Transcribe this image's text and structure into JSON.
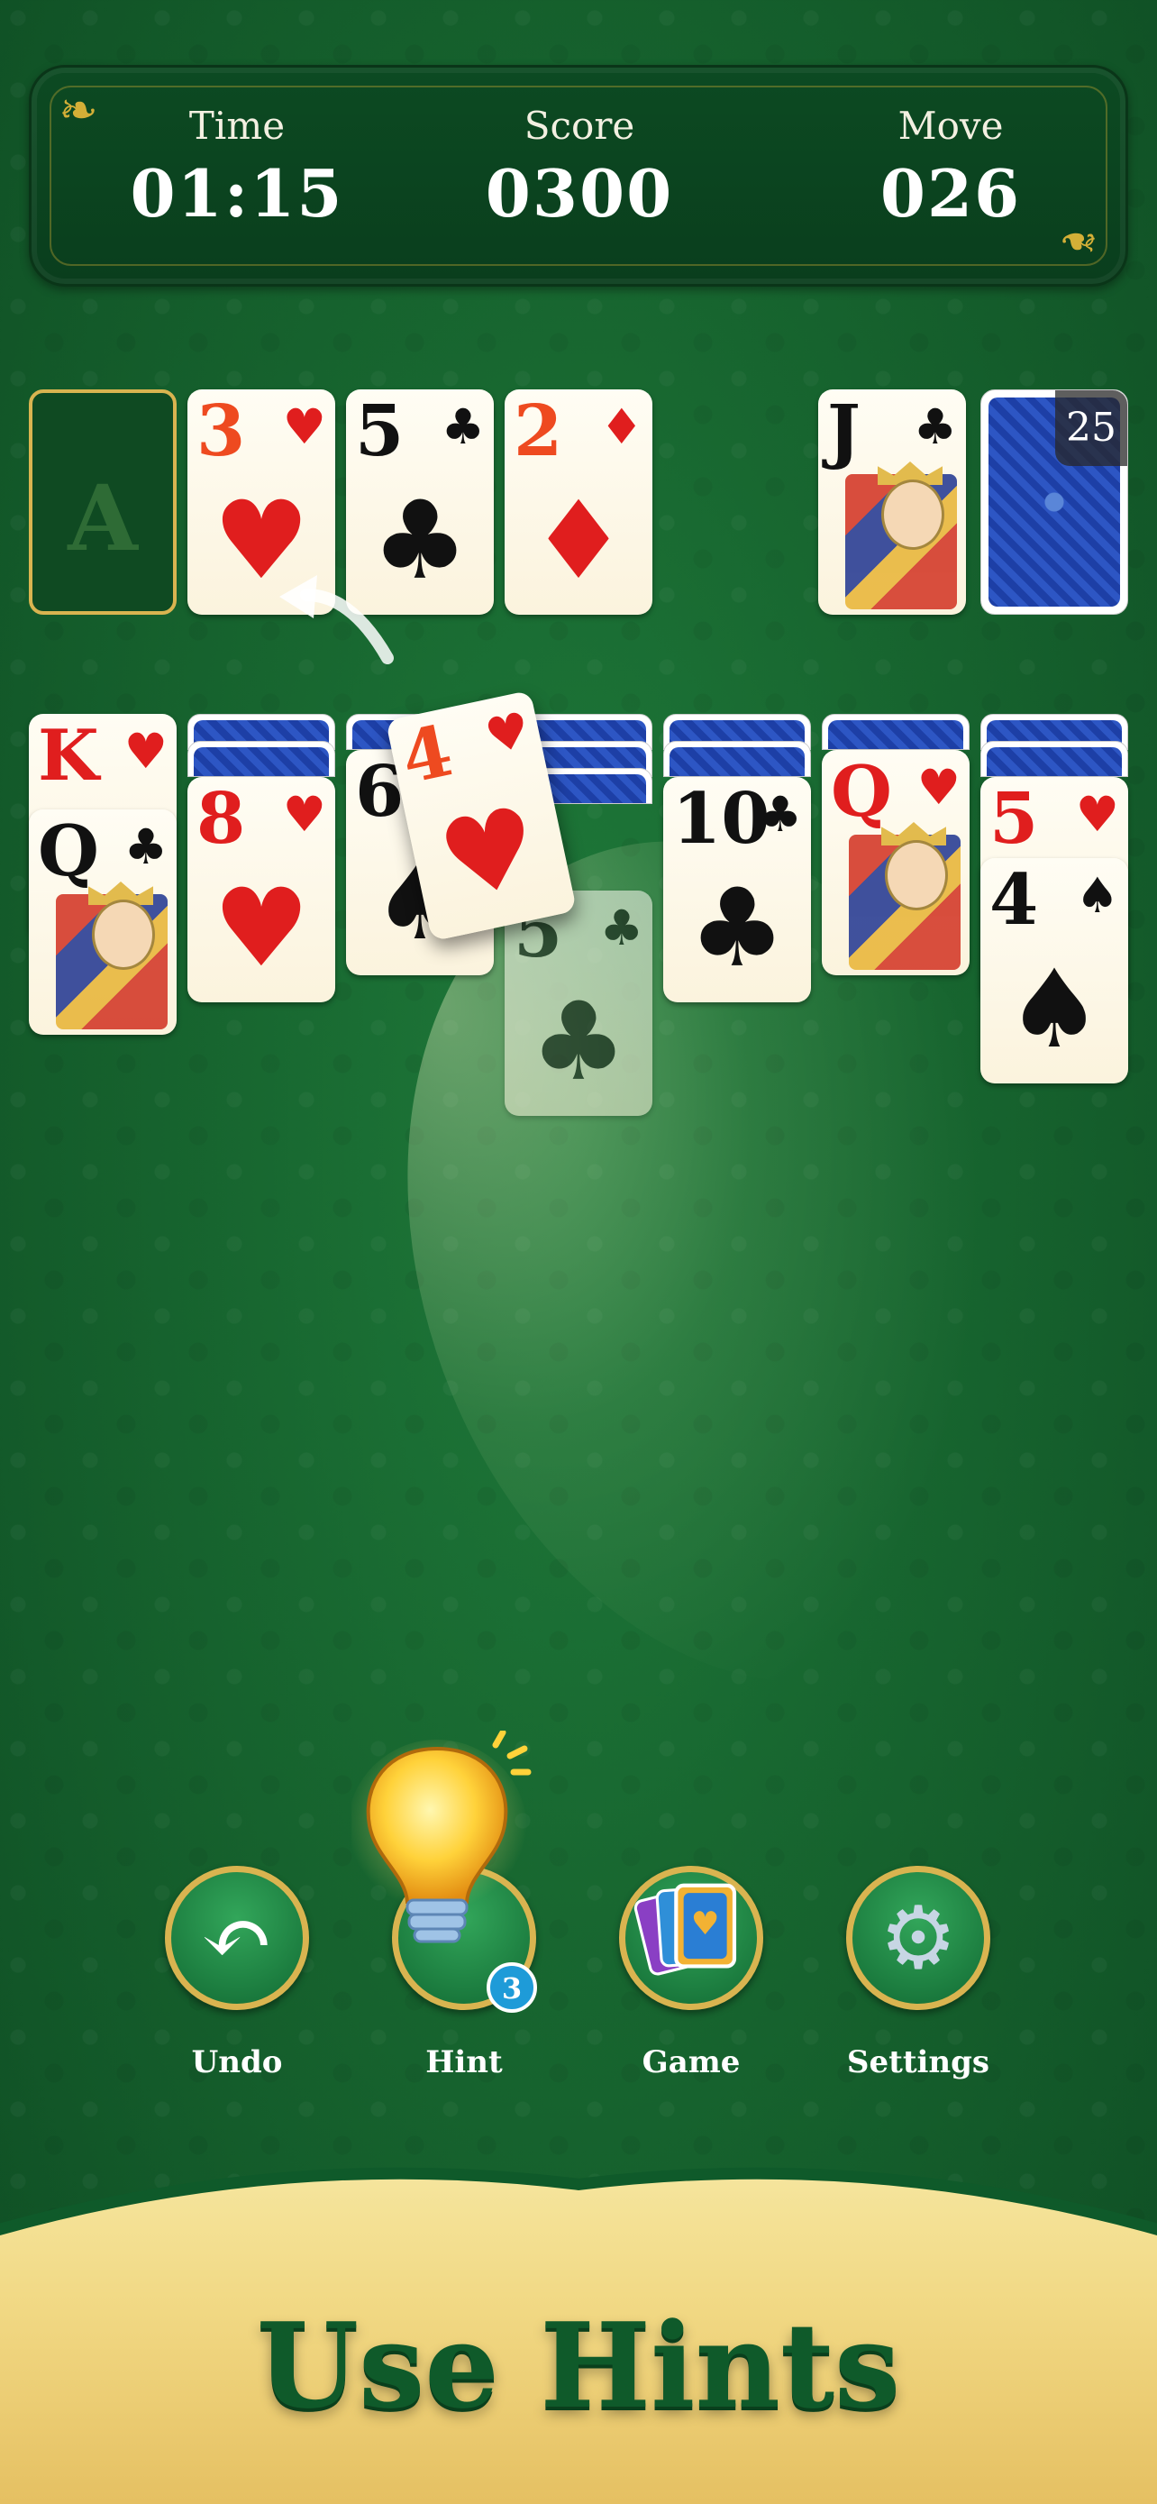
{
  "stats": {
    "time_label": "Time",
    "time_value": "01:15",
    "score_label": "Score",
    "score_value": "0300",
    "move_label": "Move",
    "move_value": "026"
  },
  "foundation": {
    "empty_label": "A",
    "cards": [
      {
        "rank": "3",
        "suit": "♥"
      },
      {
        "rank": "5",
        "suit": "♣"
      },
      {
        "rank": "2",
        "suit": "♦"
      }
    ]
  },
  "waste": {
    "rank": "J",
    "suit": "♣"
  },
  "stock": {
    "count": "25"
  },
  "tableau": [
    {
      "cards": [
        {
          "rank": "K",
          "suit": "♥"
        },
        {
          "rank": "Q",
          "suit": "♣"
        }
      ]
    },
    {
      "cards": [
        {
          "rank": "8",
          "suit": "♥"
        }
      ]
    },
    {
      "cards": [
        {
          "rank": "6",
          "suit": "♠"
        }
      ]
    },
    {
      "cards": [
        {
          "rank": "5",
          "suit": "♣"
        }
      ]
    },
    {
      "cards": [
        {
          "rank": "10",
          "suit": "♣"
        }
      ]
    },
    {
      "cards": [
        {
          "rank": "Q",
          "suit": "♥"
        }
      ]
    },
    {
      "cards": [
        {
          "rank": "5",
          "suit": "♥"
        },
        {
          "rank": "4",
          "suit": "♠"
        }
      ]
    }
  ],
  "moving_card": {
    "rank": "4",
    "suit": "♥"
  },
  "controls": {
    "undo": "Undo",
    "hint": "Hint",
    "hint_count": "3",
    "game": "Game",
    "settings": "Settings"
  },
  "banner": {
    "title": "Use Hints"
  }
}
